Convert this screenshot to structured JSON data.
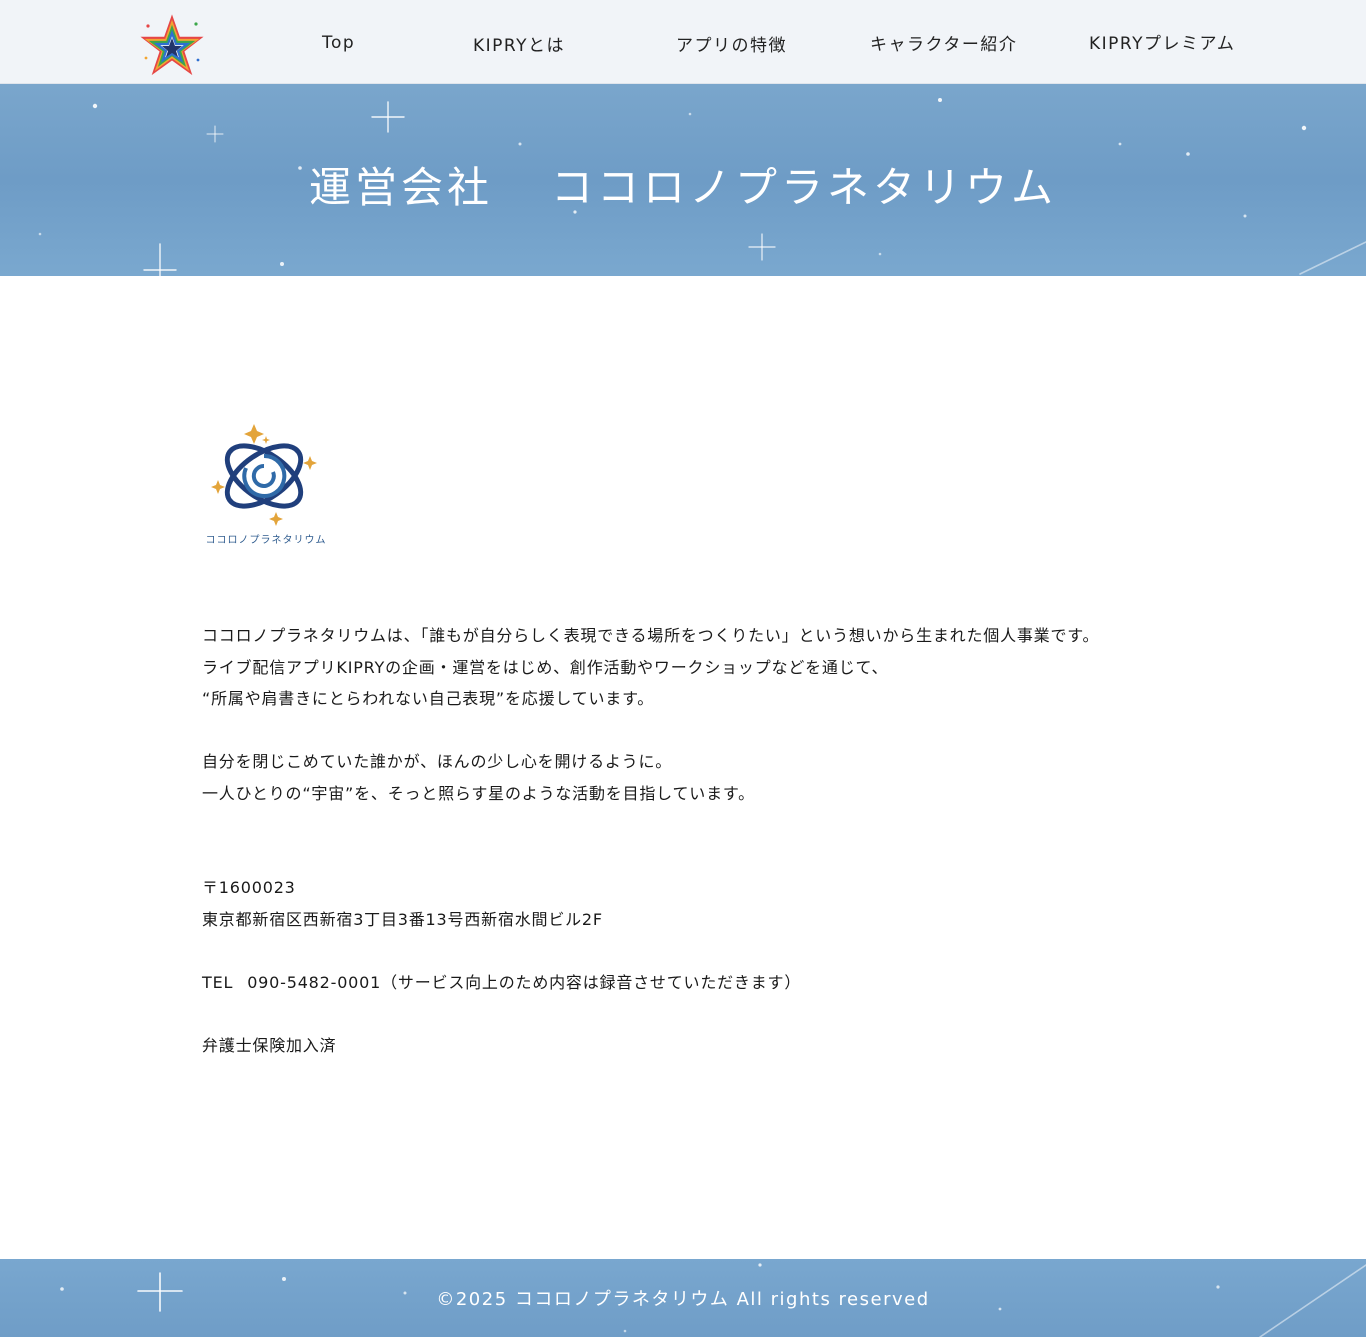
{
  "header": {
    "logo_icon": "kipry-rainbow-star-logo",
    "nav": [
      {
        "label": "Top"
      },
      {
        "label": "KIPRYとは"
      },
      {
        "label": "アプリの特徴"
      },
      {
        "label": "キャラクター紹介"
      },
      {
        "label": "KIPRYプレミアム"
      }
    ]
  },
  "hero": {
    "title_left": "運営会社",
    "title_right": "ココロノプラネタリウム"
  },
  "company": {
    "logo_icon": "kokoro-planetarium-orbit-logo",
    "logo_caption": "ココロノプラネタリウム",
    "intro_lines": [
      "ココロノプラネタリウムは、「誰もが自分らしく表現できる場所をつくりたい」という想いから生まれた個人事業です。",
      "ライブ配信アプリKIPRYの企画・運営をはじめ、創作活動やワークショップなどを通じて、",
      "“所属や肩書きにとらわれない自己表現”を応援しています。"
    ],
    "mission_lines": [
      "自分を閉じこめていた誰かが、ほんの少し心を開けるように。",
      "一人ひとりの“宇宙”を、そっと照らす星のような活動を目指しています。"
    ],
    "postal": "〒1600023",
    "address": "東京都新宿区西新宿3丁目3番13号西新宿水間ビル2F",
    "tel_label": "TEL",
    "tel_value": "090-5482-0001（サービス向上のため内容は録音させていただきます）",
    "insurance": "弁護士保険加入済"
  },
  "footer": {
    "copyright": "©2025 ココロノプラネタリウム All rights reserved"
  },
  "colors": {
    "header_bg": "#f1f4f8",
    "sky_blue": "#6e9cc6",
    "logo_navy": "#1f3f7a",
    "logo_gold": "#e3a43a"
  }
}
